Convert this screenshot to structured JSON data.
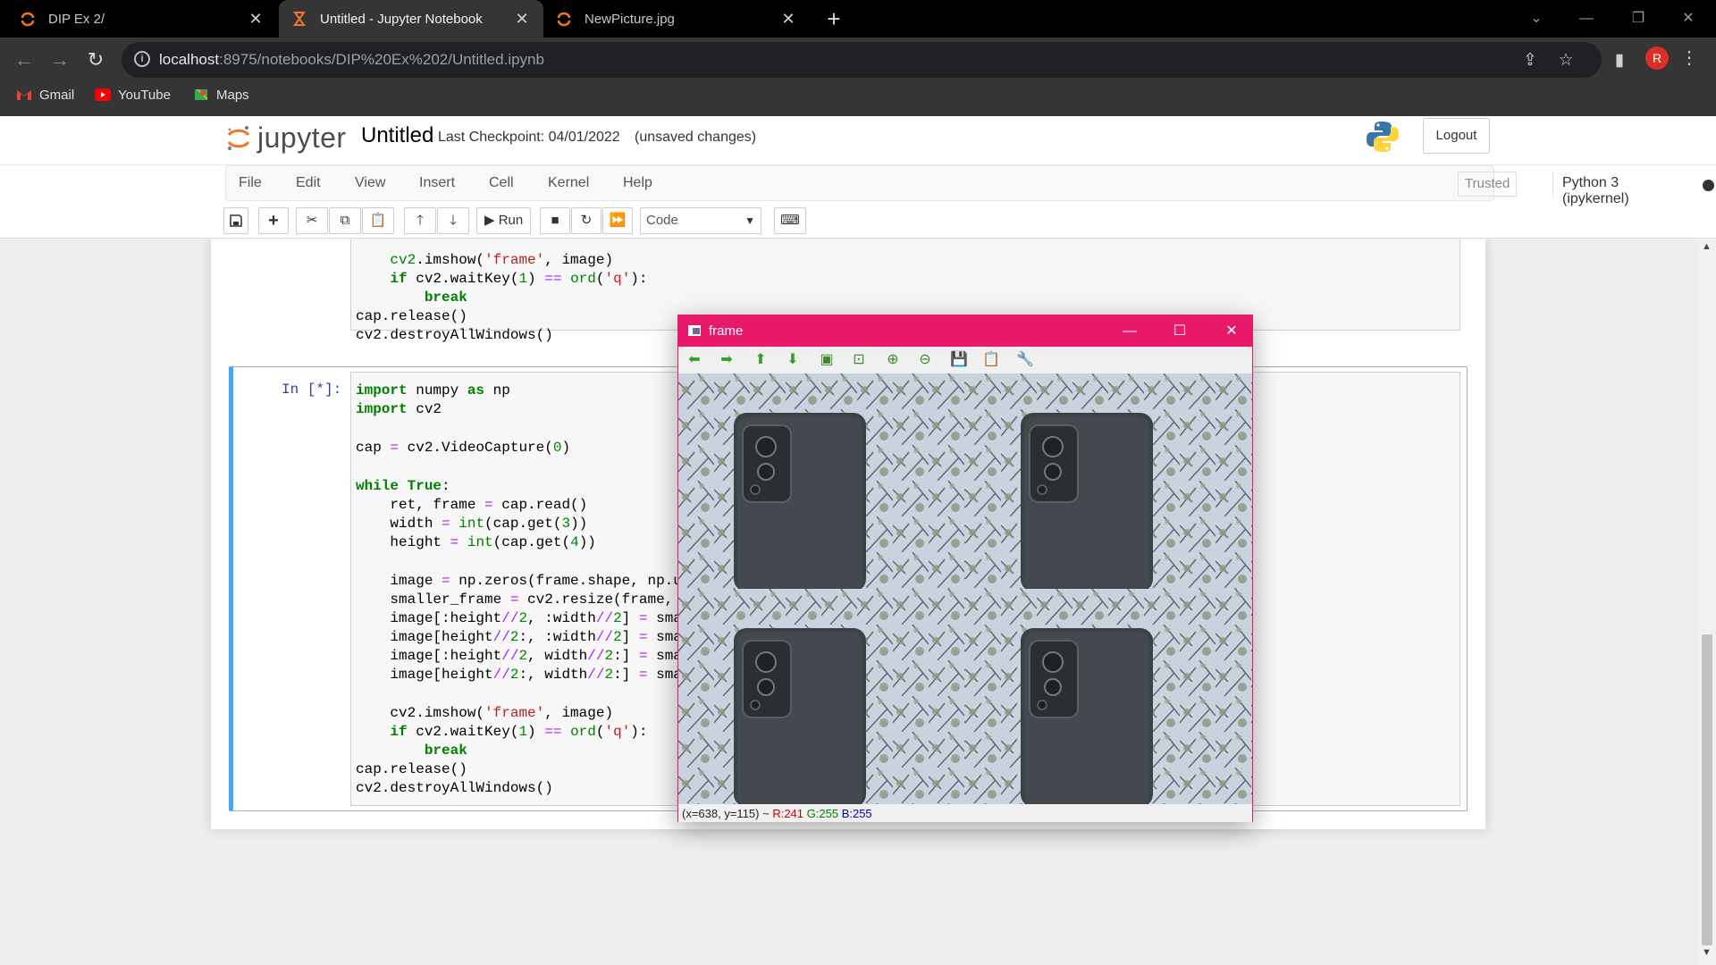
{
  "browser": {
    "tabs": [
      {
        "title": "DIP Ex 2/",
        "active": false
      },
      {
        "title": "Untitled - Jupyter Notebook",
        "active": true
      },
      {
        "title": "NewPicture.jpg",
        "active": false
      }
    ],
    "url_host": "localhost",
    "url_rest": ":8975/notebooks/DIP%20Ex%202/Untitled.ipynb",
    "bookmarks": [
      {
        "label": "Gmail",
        "icon": "gmail-icon"
      },
      {
        "label": "YouTube",
        "icon": "youtube-icon"
      },
      {
        "label": "Maps",
        "icon": "maps-icon"
      }
    ],
    "avatar_letter": "R",
    "colors": {
      "avatar": "#d93025",
      "chrome": "#353535"
    }
  },
  "jupyter": {
    "logo_text": "jupyter",
    "notebook_title": "Untitled",
    "checkpoint": "Last Checkpoint: 04/01/2022",
    "autosave": "(unsaved changes)",
    "logout_label": "Logout",
    "menu": [
      "File",
      "Edit",
      "View",
      "Insert",
      "Cell",
      "Kernel",
      "Help"
    ],
    "trusted_label": "Trusted",
    "kernel_name": "Python 3 (ipykernel)",
    "toolbar": {
      "run_label": "Run",
      "cell_type": "Code"
    }
  },
  "cells": {
    "previous_tail": [
      "    cv2.imshow('frame', image)",
      "    if cv2.waitKey(1) == ord('q'):",
      "        break",
      "cap.release()",
      "cv2.destroyAllWindows()"
    ],
    "current_prompt": "In [*]:",
    "current_code": [
      "import numpy as np",
      "import cv2",
      "",
      "cap = cv2.VideoCapture(0)",
      "",
      "while True:",
      "    ret, frame = cap.read()",
      "    width = int(cap.get(3))",
      "    height = int(cap.get(4))",
      "",
      "    image = np.zeros(frame.shape, np.u",
      "    smaller_frame = cv2.resize(frame,",
      "    image[:height//2, :width//2] = sma",
      "    image[height//2:, :width//2] = sma",
      "    image[:height//2, width//2:] = sma",
      "    image[height//2:, width//2:] = sma",
      "",
      "    cv2.imshow('frame', image)",
      "    if cv2.waitKey(1) == ord('q'):",
      "        break",
      "cap.release()",
      "cv2.destroyAllWindows()"
    ]
  },
  "cv_window": {
    "title": "frame",
    "status_coords": "(x=638, y=115) ~",
    "status_r": "R:241",
    "status_g": "G:255",
    "status_b": "B:255",
    "title_color": "#e8196b"
  }
}
